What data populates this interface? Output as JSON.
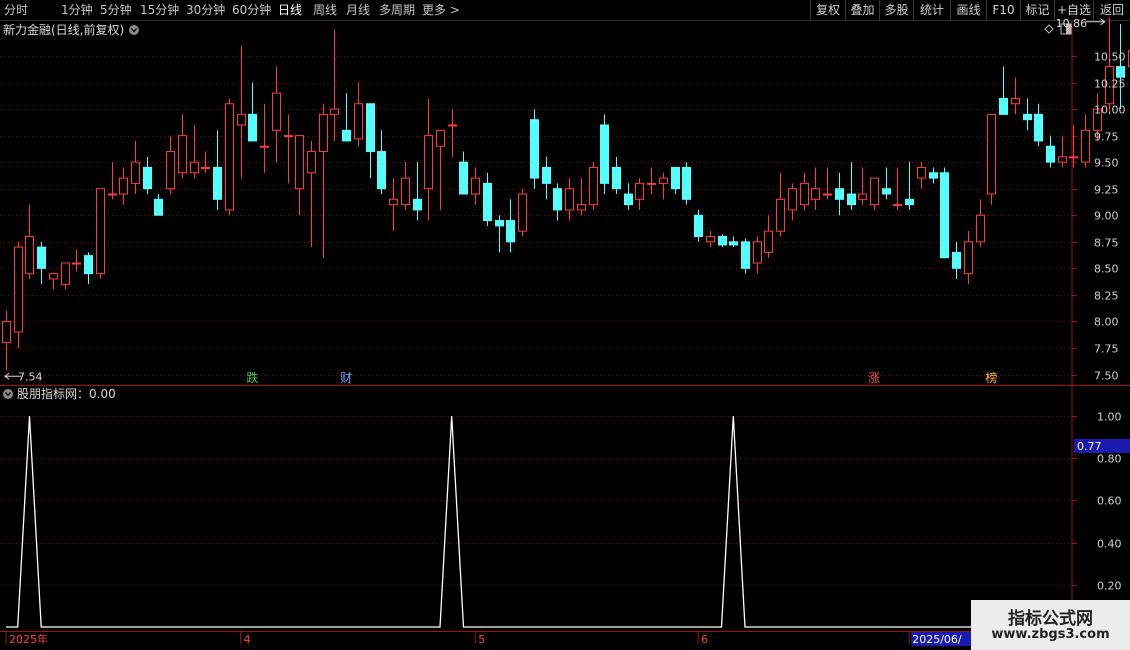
{
  "toolbar": {
    "left_items": [
      "分时",
      "1分钟",
      "5分钟",
      "15分钟",
      "30分钟",
      "60分钟",
      "日线",
      "周线",
      "月线",
      "多周期",
      "更多 >"
    ],
    "active_index": 6,
    "right_items": [
      "复权",
      "叠加",
      "多股",
      "统计",
      "画线",
      "F10",
      "标记",
      "+自选",
      "返回"
    ]
  },
  "main": {
    "title": "新力金融(日线,前复权)",
    "high_label": "10.86",
    "low_label": "7.54",
    "events": [
      {
        "text": "跌",
        "color": "#3fcf3f",
        "i": 21
      },
      {
        "text": "财",
        "color": "#6fa0ff",
        "i": 29
      },
      {
        "text": "涨",
        "color": "#ff4848",
        "i": 74
      },
      {
        "text": "榜",
        "color": "#ffb040",
        "i": 84
      }
    ]
  },
  "indicator": {
    "title": "股朋指标网：0.00",
    "current_label": "0.77"
  },
  "timeline": {
    "labels": [
      {
        "text": "2025年",
        "i": 0
      },
      {
        "text": "4",
        "i": 20
      },
      {
        "text": "5",
        "i": 40
      },
      {
        "text": "6",
        "i": 59
      },
      {
        "text": "2025/06/",
        "i": 77
      }
    ]
  },
  "watermark": {
    "line1": "指标公式网",
    "line2": "www.zbgs3.com"
  },
  "colors": {
    "up": "#ff3c3c",
    "down": "#54ffff",
    "grid": "#8b0000",
    "indicator_line": "#ffffff"
  },
  "chart_data": [
    {
      "type": "candlestick",
      "y_ticks": [
        7.5,
        7.75,
        8.0,
        8.25,
        8.5,
        8.75,
        9.0,
        9.25,
        9.5,
        9.75,
        10.0,
        10.25,
        10.5
      ],
      "ylim": [
        7.42,
        10.82
      ],
      "ohlc": [
        [
          7.8,
          8.1,
          7.54,
          8.0
        ],
        [
          7.9,
          8.75,
          7.75,
          8.7
        ],
        [
          8.45,
          9.1,
          8.4,
          8.8
        ],
        [
          8.7,
          8.75,
          8.35,
          8.5
        ],
        [
          8.4,
          8.45,
          8.3,
          8.45
        ],
        [
          8.35,
          8.55,
          8.3,
          8.55
        ],
        [
          8.55,
          8.68,
          8.47,
          8.55
        ],
        [
          8.62,
          8.65,
          8.35,
          8.45
        ],
        [
          8.45,
          9.25,
          8.4,
          9.25
        ],
        [
          9.2,
          9.5,
          9.15,
          9.2
        ],
        [
          9.2,
          9.45,
          9.1,
          9.35
        ],
        [
          9.3,
          9.7,
          9.2,
          9.5
        ],
        [
          9.45,
          9.55,
          9.2,
          9.25
        ],
        [
          9.15,
          9.2,
          9.0,
          9.0
        ],
        [
          9.25,
          9.75,
          9.2,
          9.6
        ],
        [
          9.4,
          9.95,
          9.35,
          9.75
        ],
        [
          9.4,
          9.85,
          9.35,
          9.5
        ],
        [
          9.45,
          9.6,
          9.4,
          9.45
        ],
        [
          9.45,
          9.8,
          9.05,
          9.15
        ],
        [
          9.05,
          10.1,
          9.0,
          10.05
        ],
        [
          9.85,
          10.6,
          9.35,
          9.95
        ],
        [
          9.95,
          10.25,
          9.7,
          9.7
        ],
        [
          9.65,
          10.05,
          9.4,
          9.65
        ],
        [
          9.8,
          10.4,
          9.5,
          10.15
        ],
        [
          9.75,
          9.95,
          9.3,
          9.75
        ],
        [
          9.25,
          9.75,
          9.0,
          9.75
        ],
        [
          9.4,
          9.7,
          8.7,
          9.6
        ],
        [
          9.6,
          10.05,
          8.6,
          9.95
        ],
        [
          9.95,
          10.75,
          9.7,
          10.0
        ],
        [
          9.8,
          10.15,
          9.7,
          9.7
        ],
        [
          9.72,
          10.25,
          9.65,
          10.05
        ],
        [
          10.05,
          10.05,
          9.35,
          9.6
        ],
        [
          9.6,
          9.8,
          9.2,
          9.25
        ],
        [
          9.1,
          9.35,
          8.85,
          9.15
        ],
        [
          9.1,
          9.5,
          9.05,
          9.35
        ],
        [
          9.15,
          9.5,
          8.95,
          9.05
        ],
        [
          9.25,
          10.1,
          8.95,
          9.75
        ],
        [
          9.65,
          9.8,
          9.05,
          9.8
        ],
        [
          9.85,
          10.0,
          9.55,
          9.85
        ],
        [
          9.5,
          9.6,
          9.25,
          9.2
        ],
        [
          9.2,
          9.45,
          9.1,
          9.35
        ],
        [
          9.3,
          9.4,
          8.9,
          8.95
        ],
        [
          8.95,
          9.0,
          8.65,
          8.9
        ],
        [
          8.95,
          9.15,
          8.65,
          8.75
        ],
        [
          8.85,
          9.25,
          8.8,
          9.2
        ],
        [
          9.9,
          10.0,
          9.25,
          9.35
        ],
        [
          9.45,
          9.55,
          9.15,
          9.3
        ],
        [
          9.25,
          9.3,
          8.95,
          9.05
        ],
        [
          9.05,
          9.35,
          8.95,
          9.25
        ],
        [
          9.05,
          9.35,
          9.0,
          9.1
        ],
        [
          9.1,
          9.5,
          9.05,
          9.45
        ],
        [
          9.85,
          9.95,
          9.2,
          9.3
        ],
        [
          9.45,
          9.55,
          9.2,
          9.25
        ],
        [
          9.2,
          9.3,
          9.05,
          9.1
        ],
        [
          9.15,
          9.35,
          9.05,
          9.3
        ],
        [
          9.3,
          9.45,
          9.2,
          9.3
        ],
        [
          9.3,
          9.4,
          9.15,
          9.35
        ],
        [
          9.45,
          9.45,
          9.2,
          9.25
        ],
        [
          9.45,
          9.5,
          9.1,
          9.15
        ],
        [
          9.0,
          9.05,
          8.75,
          8.8
        ],
        [
          8.75,
          8.85,
          8.7,
          8.8
        ],
        [
          8.8,
          8.82,
          8.7,
          8.72
        ],
        [
          8.75,
          8.8,
          8.7,
          8.72
        ],
        [
          8.75,
          8.78,
          8.45,
          8.5
        ],
        [
          8.55,
          8.8,
          8.45,
          8.75
        ],
        [
          8.65,
          9.0,
          8.6,
          8.85
        ],
        [
          8.85,
          9.4,
          8.8,
          9.15
        ],
        [
          9.05,
          9.3,
          8.95,
          9.25
        ],
        [
          9.1,
          9.4,
          9.05,
          9.3
        ],
        [
          9.15,
          9.45,
          9.05,
          9.25
        ],
        [
          9.2,
          9.45,
          9.15,
          9.2
        ],
        [
          9.25,
          9.4,
          9.0,
          9.15
        ],
        [
          9.2,
          9.5,
          9.05,
          9.1
        ],
        [
          9.15,
          9.45,
          9.1,
          9.2
        ],
        [
          9.1,
          9.35,
          9.05,
          9.35
        ],
        [
          9.25,
          9.45,
          9.15,
          9.2
        ],
        [
          9.1,
          9.45,
          9.05,
          9.1
        ],
        [
          9.15,
          9.5,
          9.05,
          9.1
        ],
        [
          9.35,
          9.5,
          9.25,
          9.45
        ],
        [
          9.4,
          9.45,
          9.3,
          9.35
        ],
        [
          9.4,
          9.45,
          8.9,
          8.6
        ],
        [
          8.65,
          8.75,
          8.4,
          8.5
        ],
        [
          8.45,
          8.85,
          8.35,
          8.75
        ],
        [
          8.75,
          9.15,
          8.7,
          9.0
        ],
        [
          9.2,
          9.95,
          9.1,
          9.95
        ],
        [
          10.1,
          10.4,
          9.95,
          9.95
        ],
        [
          10.05,
          10.3,
          9.95,
          10.1
        ],
        [
          9.95,
          10.1,
          9.8,
          9.9
        ],
        [
          9.95,
          10.05,
          9.65,
          9.7
        ],
        [
          9.65,
          9.75,
          9.45,
          9.5
        ],
        [
          9.5,
          9.75,
          9.45,
          9.55
        ],
        [
          9.55,
          9.85,
          9.45,
          9.55
        ],
        [
          9.5,
          9.95,
          9.45,
          9.8
        ],
        [
          9.8,
          10.15,
          9.7,
          10.0
        ],
        [
          10.05,
          10.86,
          9.95,
          10.4
        ],
        [
          10.4,
          10.8,
          10.0,
          10.3
        ],
        [
          10.4,
          10.7,
          10.1,
          10.55
        ]
      ]
    },
    {
      "type": "line",
      "name": "股朋指标网",
      "y_ticks": [
        0.2,
        0.4,
        0.6,
        0.8,
        1.0
      ],
      "ylim": [
        0.0,
        1.1
      ],
      "values": [
        0,
        0,
        1,
        0,
        0,
        0,
        0,
        0,
        0,
        0,
        0,
        0,
        0,
        0,
        0,
        0,
        0,
        0,
        0,
        0,
        0,
        0,
        0,
        0,
        0,
        0,
        0,
        0,
        0,
        0,
        0,
        0,
        0,
        0,
        0,
        0,
        0,
        0,
        1,
        0,
        0,
        0,
        0,
        0,
        0,
        0,
        0,
        0,
        0,
        0,
        0,
        0,
        0,
        0,
        0,
        0,
        0,
        0,
        0,
        0,
        0,
        0,
        1,
        0,
        0,
        0,
        0,
        0,
        0,
        0,
        0,
        0,
        0,
        0,
        0,
        0,
        0,
        0,
        0,
        0,
        0,
        0,
        0,
        0,
        0,
        0,
        0,
        0,
        0,
        0,
        0,
        0,
        0,
        0,
        0,
        0,
        0
      ]
    }
  ]
}
